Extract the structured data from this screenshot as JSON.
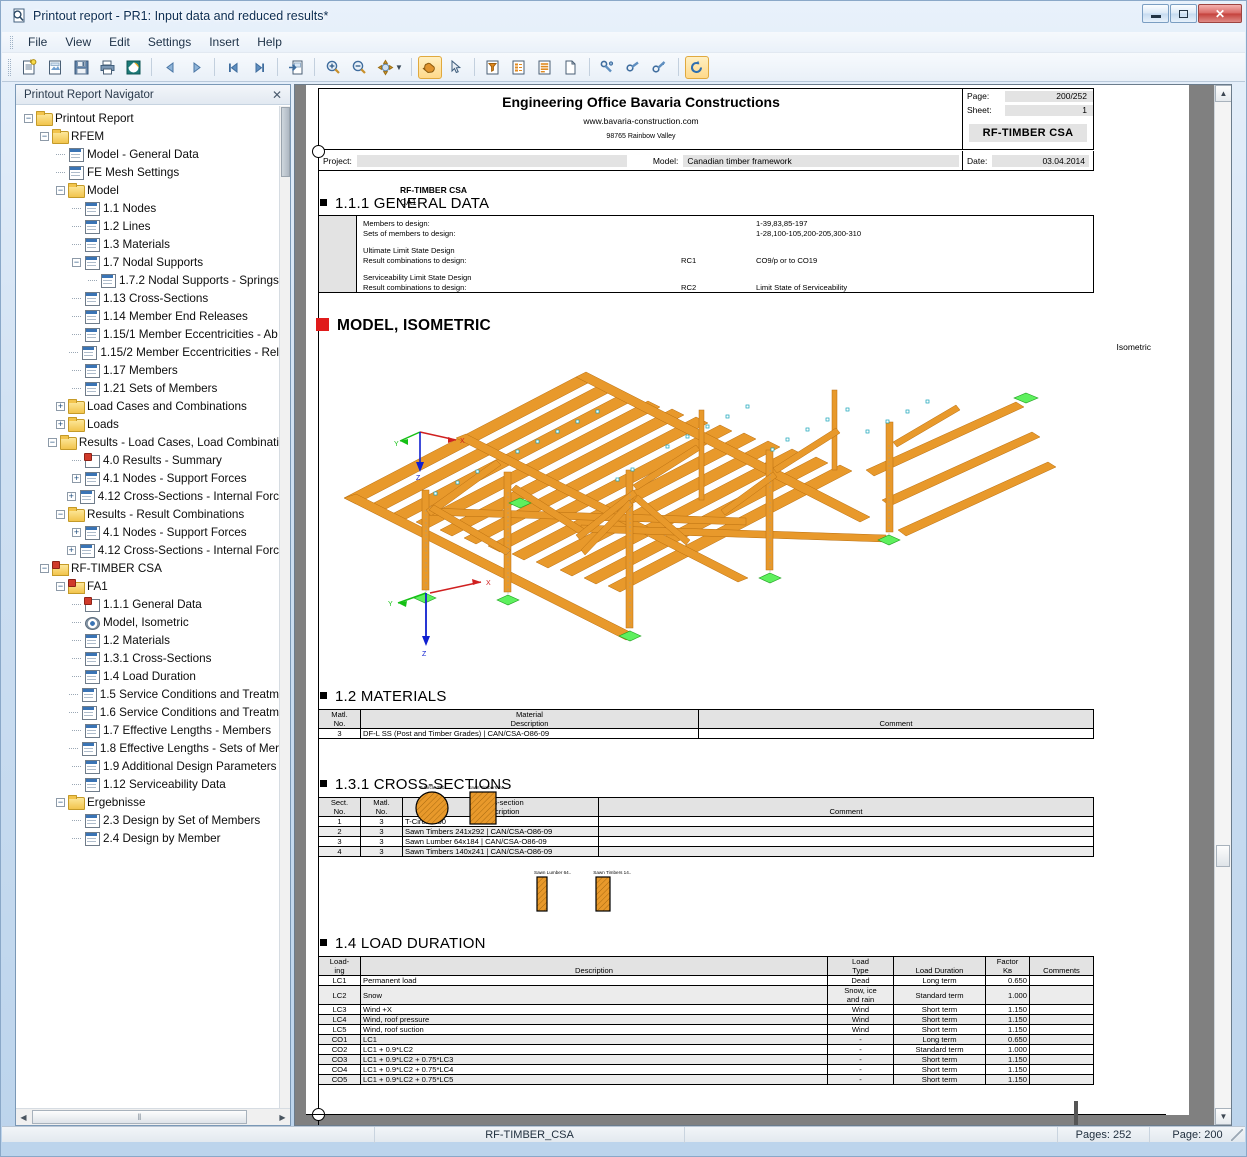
{
  "window": {
    "title": "Printout report - PR1: Input data and reduced results*",
    "title_icon": "magnifier-page-icon",
    "minimize": "–",
    "maximize": "❐",
    "close": "✕"
  },
  "menu": {
    "items": [
      {
        "label": "File"
      },
      {
        "label": "View"
      },
      {
        "label": "Edit"
      },
      {
        "label": "Settings"
      },
      {
        "label": "Insert"
      },
      {
        "label": "Help"
      }
    ]
  },
  "toolbar": {
    "buttons": [
      {
        "name": "new-report-icon",
        "glyph": "📄",
        "active": false
      },
      {
        "name": "open-report-icon",
        "glyph": "📂",
        "active": false
      },
      {
        "name": "save-report-icon",
        "glyph": "💾",
        "active": false
      },
      {
        "name": "print-icon",
        "glyph": "🖨",
        "active": false
      },
      {
        "name": "print-preview-icon",
        "glyph": "◑",
        "active": false
      },
      {
        "name": "previous-page-icon",
        "glyph": "◀",
        "active": false
      },
      {
        "name": "next-page-icon",
        "glyph": "▶",
        "active": false
      },
      {
        "name": "first-page-icon",
        "glyph": "⏮",
        "active": false
      },
      {
        "name": "last-page-icon",
        "glyph": "⏭",
        "active": false
      },
      {
        "name": "export-page-icon",
        "glyph": "⇥",
        "active": false
      },
      {
        "name": "zoom-in-icon",
        "glyph": "🔍",
        "active": false
      },
      {
        "name": "zoom-out-icon",
        "glyph": "🔎",
        "active": false
      },
      {
        "name": "pan-mode-icon",
        "glyph": "✥",
        "active": false
      },
      {
        "name": "hand-tool-icon",
        "glyph": "✋",
        "active": true
      },
      {
        "name": "select-arrow-icon",
        "glyph": "↖",
        "active": false
      },
      {
        "name": "filter-selection-icon",
        "glyph": "▽",
        "active": false
      },
      {
        "name": "page-layout-icon",
        "glyph": "▤",
        "active": false
      },
      {
        "name": "page-content-icon",
        "glyph": "≡",
        "active": false
      },
      {
        "name": "blank-page-icon",
        "glyph": "▯",
        "active": false
      },
      {
        "name": "link-all-icon",
        "glyph": "🔗",
        "active": false
      },
      {
        "name": "link-partial-icon",
        "glyph": "🔑",
        "active": false
      },
      {
        "name": "lock-icon",
        "glyph": "🔒",
        "active": false
      },
      {
        "name": "refresh-report-icon",
        "glyph": "↻",
        "active": true
      }
    ]
  },
  "navigator": {
    "header": "Printout Report Navigator",
    "close_glyph": "✕",
    "tree": [
      {
        "depth": 0,
        "label": "Printout Report",
        "icon": "folder",
        "expander": "minus"
      },
      {
        "depth": 1,
        "label": "RFEM",
        "icon": "folder",
        "expander": "minus"
      },
      {
        "depth": 2,
        "label": "Model - General Data",
        "icon": "table",
        "expander": "none"
      },
      {
        "depth": 2,
        "label": "FE Mesh Settings",
        "icon": "table",
        "expander": "none"
      },
      {
        "depth": 2,
        "label": "Model",
        "icon": "folder",
        "expander": "minus"
      },
      {
        "depth": 3,
        "label": "1.1 Nodes",
        "icon": "table",
        "expander": "none"
      },
      {
        "depth": 3,
        "label": "1.2 Lines",
        "icon": "table",
        "expander": "none"
      },
      {
        "depth": 3,
        "label": "1.3 Materials",
        "icon": "table",
        "expander": "none"
      },
      {
        "depth": 3,
        "label": "1.7 Nodal Supports",
        "icon": "table",
        "expander": "minus"
      },
      {
        "depth": 4,
        "label": "1.7.2 Nodal Supports - Springs",
        "icon": "table",
        "expander": "none"
      },
      {
        "depth": 3,
        "label": "1.13 Cross-Sections",
        "icon": "table",
        "expander": "none"
      },
      {
        "depth": 3,
        "label": "1.14 Member End Releases",
        "icon": "table",
        "expander": "none"
      },
      {
        "depth": 3,
        "label": "1.15/1 Member Eccentricities - Ab",
        "icon": "table",
        "expander": "none"
      },
      {
        "depth": 3,
        "label": "1.15/2 Member Eccentricities - Rel",
        "icon": "table",
        "expander": "none"
      },
      {
        "depth": 3,
        "label": "1.17 Members",
        "icon": "table",
        "expander": "none"
      },
      {
        "depth": 3,
        "label": "1.21 Sets of Members",
        "icon": "table",
        "expander": "none"
      },
      {
        "depth": 2,
        "label": "Load Cases and Combinations",
        "icon": "folder",
        "expander": "plus"
      },
      {
        "depth": 2,
        "label": "Loads",
        "icon": "folder",
        "expander": "plus"
      },
      {
        "depth": 2,
        "label": "Results - Load Cases, Load Combinati",
        "icon": "folder",
        "expander": "minus"
      },
      {
        "depth": 3,
        "label": "4.0 Results - Summary",
        "icon": "tablepin",
        "expander": "none"
      },
      {
        "depth": 3,
        "label": "4.1 Nodes - Support Forces",
        "icon": "table",
        "expander": "plus"
      },
      {
        "depth": 3,
        "label": "4.12 Cross-Sections - Internal Forc",
        "icon": "table",
        "expander": "plus"
      },
      {
        "depth": 2,
        "label": "Results - Result Combinations",
        "icon": "folder",
        "expander": "minus"
      },
      {
        "depth": 3,
        "label": "4.1 Nodes - Support Forces",
        "icon": "table",
        "expander": "plus"
      },
      {
        "depth": 3,
        "label": "4.12 Cross-Sections - Internal Forc",
        "icon": "table",
        "expander": "plus"
      },
      {
        "depth": 1,
        "label": "RF-TIMBER CSA",
        "icon": "folderpin",
        "expander": "minus"
      },
      {
        "depth": 2,
        "label": "FA1",
        "icon": "folderpin",
        "expander": "minus"
      },
      {
        "depth": 3,
        "label": "1.1.1 General Data",
        "icon": "tablepin",
        "expander": "none"
      },
      {
        "depth": 3,
        "label": "Model, Isometric",
        "icon": "eye",
        "expander": "none"
      },
      {
        "depth": 3,
        "label": "1.2 Materials",
        "icon": "table",
        "expander": "none"
      },
      {
        "depth": 3,
        "label": "1.3.1 Cross-Sections",
        "icon": "table",
        "expander": "none"
      },
      {
        "depth": 3,
        "label": "1.4 Load Duration",
        "icon": "table",
        "expander": "none"
      },
      {
        "depth": 3,
        "label": "1.5 Service Conditions and Treatm",
        "icon": "table",
        "expander": "none"
      },
      {
        "depth": 3,
        "label": "1.6 Service Conditions and Treatm",
        "icon": "table",
        "expander": "none"
      },
      {
        "depth": 3,
        "label": "1.7 Effective Lengths - Members",
        "icon": "table",
        "expander": "none"
      },
      {
        "depth": 3,
        "label": "1.8 Effective Lengths - Sets of Mer",
        "icon": "table",
        "expander": "none"
      },
      {
        "depth": 3,
        "label": "1.9 Additional Design Parameters",
        "icon": "table",
        "expander": "none"
      },
      {
        "depth": 3,
        "label": "1.12  Serviceability Data",
        "icon": "table",
        "expander": "none"
      },
      {
        "depth": 2,
        "label": "Ergebnisse",
        "icon": "folder",
        "expander": "minus"
      },
      {
        "depth": 3,
        "label": "2.3 Design by Set of Members",
        "icon": "table",
        "expander": "none"
      },
      {
        "depth": 3,
        "label": "2.4 Design by Member",
        "icon": "table",
        "expander": "none"
      }
    ],
    "hscroll_grip": "‖",
    "hscroll_left": "◀",
    "hscroll_right": "▶"
  },
  "document": {
    "header": {
      "company": "Engineering Office Bavaria Constructions",
      "website": "www.bavaria-construction.com",
      "address": "98765 Rainbow Valley",
      "page_label": "Page:",
      "page_value": "200/252",
      "sheet_label": "Sheet:",
      "sheet_value": "1",
      "module": "RF-TIMBER CSA"
    },
    "projrow": {
      "project_label": "Project:",
      "project_value": "",
      "model_label": "Model:",
      "model_value": "Canadian timber framework",
      "date_label": "Date:",
      "date_value": "03.04.2014"
    },
    "margin_note": {
      "line1": "RF-TIMBER CSA",
      "line2": "CA1",
      "page_marker": "1"
    },
    "sections": {
      "general_data": {
        "title": "1.1.1 GENERAL DATA",
        "rows": [
          {
            "label": "Members to design:",
            "mid": "",
            "value": "1-39,83,85-197"
          },
          {
            "label": "Sets of members to design:",
            "mid": "",
            "value": "1-28,100-105,200-205,300-310"
          },
          {
            "label": "",
            "mid": "",
            "value": ""
          },
          {
            "label": "Ultimate Limit State Design",
            "mid": "",
            "value": ""
          },
          {
            "label": "Result combinations to design:",
            "mid": "RC1",
            "value": "CO9/p or to CO19"
          },
          {
            "label": "",
            "mid": "",
            "value": ""
          },
          {
            "label": "Serviceability Limit State Design",
            "mid": "",
            "value": ""
          },
          {
            "label": "Result combinations to design:",
            "mid": "RC2",
            "value": "Limit State of Serviceability"
          }
        ]
      },
      "model_isometric": {
        "title": "MODEL, ISOMETRIC",
        "view_label": "Isometric",
        "axes": {
          "x": "X",
          "y": "Y",
          "z": "Z"
        }
      },
      "materials": {
        "title": "1.2 MATERIALS",
        "headers": [
          {
            "line1": "Matl.",
            "line2": "No."
          },
          {
            "line1": "Material",
            "line2": "Description"
          },
          {
            "line1": "",
            "line2": "Comment"
          }
        ],
        "rows": [
          {
            "no": "3",
            "description": "DF-L SS (Post and Timber Grades) | CAN/CSA-O86-09",
            "comment": ""
          }
        ]
      },
      "cross_sections": {
        "title": "1.3.1 CROSS-SECTIONS",
        "headers": [
          {
            "line1": "Sect.",
            "line2": "No."
          },
          {
            "line1": "Matl.",
            "line2": "No."
          },
          {
            "line1": "Cross-section",
            "line2": "Description"
          },
          {
            "line1": "",
            "line2": "Comment"
          }
        ],
        "rows": [
          {
            "sect": "1",
            "matl": "3",
            "description": "T-Circle 250",
            "comment": ""
          },
          {
            "sect": "2",
            "matl": "3",
            "description": "Sawn Timbers 241x292 | CAN/CSA-O86-09",
            "comment": ""
          },
          {
            "sect": "3",
            "matl": "3",
            "description": "Sawn Lumber 64x184 | CAN/CSA-O86-09",
            "comment": ""
          },
          {
            "sect": "4",
            "matl": "3",
            "description": "Sawn Timbers 140x241 | CAN/CSA-O86-09",
            "comment": ""
          }
        ],
        "figures_top": [
          {
            "label": "T-Circle 250",
            "shape": "circle"
          },
          {
            "label": "Sawn Timbers 24..",
            "shape": "rect-wide"
          }
        ],
        "figures_bottom": [
          {
            "label": "Sawn Lumber 64..",
            "shape": "rect-narrow"
          },
          {
            "label": "Sawn Timbers 14..",
            "shape": "rect-narrow"
          }
        ]
      },
      "load_duration": {
        "title": "1.4 LOAD DURATION",
        "headers": [
          {
            "line1": "Load-",
            "line2": "ing"
          },
          {
            "line1": "",
            "line2": "Description"
          },
          {
            "line1": "Load",
            "line2": "Type"
          },
          {
            "line1": "",
            "line2": "Load Duration"
          },
          {
            "line1": "Factor",
            "line2": "Kʙ"
          },
          {
            "line1": "",
            "line2": "Comments"
          }
        ],
        "rows": [
          {
            "loading": "LC1",
            "description": "Permanent load",
            "type": "Dead",
            "duration": "Long term",
            "factor": "0.650",
            "comments": ""
          },
          {
            "loading": "LC2",
            "description": "Snow",
            "type": "Snow, ice\nand rain",
            "duration": "Standard term",
            "factor": "1.000",
            "comments": ""
          },
          {
            "loading": "LC3",
            "description": "Wind +X",
            "type": "Wind",
            "duration": "Short term",
            "factor": "1.150",
            "comments": ""
          },
          {
            "loading": "LC4",
            "description": "Wind, roof pressure",
            "type": "Wind",
            "duration": "Short term",
            "factor": "1.150",
            "comments": ""
          },
          {
            "loading": "LC5",
            "description": "Wind, roof suction",
            "type": "Wind",
            "duration": "Short term",
            "factor": "1.150",
            "comments": ""
          },
          {
            "loading": "CO1",
            "description": "LC1",
            "type": "-",
            "duration": "Long term",
            "factor": "0.650",
            "comments": ""
          },
          {
            "loading": "CO2",
            "description": "LC1 + 0.9*LC2",
            "type": "-",
            "duration": "Standard term",
            "factor": "1.000",
            "comments": ""
          },
          {
            "loading": "CO3",
            "description": "LC1 + 0.9*LC2 + 0.75*LC3",
            "type": "-",
            "duration": "Short term",
            "factor": "1.150",
            "comments": ""
          },
          {
            "loading": "CO4",
            "description": "LC1 + 0.9*LC2 + 0.75*LC4",
            "type": "-",
            "duration": "Short term",
            "factor": "1.150",
            "comments": ""
          },
          {
            "loading": "CO5",
            "description": "LC1 + 0.9*LC2 + 0.75*LC5",
            "type": "-",
            "duration": "Short term",
            "factor": "1.150",
            "comments": ""
          }
        ]
      }
    }
  },
  "statusbar": {
    "module": "RF-TIMBER_CSA",
    "pages": "Pages: 252",
    "page": "Page: 200"
  },
  "colors": {
    "accent": "#3a74b5",
    "timber": "#e8992b",
    "support": "#5ef05e",
    "axis_x": "#d02020",
    "axis_y": "#15c015",
    "axis_z": "#1020d0",
    "section_red": "#e01b1b"
  }
}
